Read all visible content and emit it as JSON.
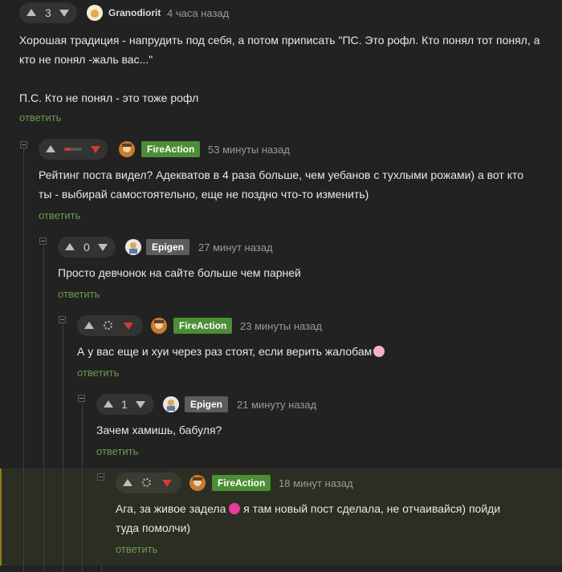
{
  "comments": [
    {
      "rating": "3",
      "author": "Granodiorit",
      "time": "4 часа назад",
      "text_lines": [
        "Хорошая традиция - напрудить под себя, а потом приписать \"ПС. Это рофл. Кто понял тот понял, а",
        "кто не понял -жаль вас...\"",
        "",
        "П.С. Кто не понял - это тоже рофл"
      ],
      "reply": "ответить"
    },
    {
      "author": "FireAction",
      "time": "53 минуты назад",
      "text_lines": [
        "Рейтинг поста видел? Адекватов в 4 раза больше, чем уебанов с тухлыми рожами) а вот кто",
        "ты - выбирай самостоятельно, еще не поздно что-то изменить)"
      ],
      "reply": "ответить"
    },
    {
      "rating": "0",
      "author": "Epigen",
      "time": "27 минут назад",
      "text_lines": [
        "Просто девчонок на сайте больше чем парней"
      ],
      "reply": "ответить"
    },
    {
      "author": "FireAction",
      "time": "23 минуты назад",
      "text": "А у вас еще и хуи через раз стоят, если верить жалобам",
      "reply": "ответить"
    },
    {
      "rating": "1",
      "author": "Epigen",
      "time": "21 минуту назад",
      "text_lines": [
        "Зачем хамишь, бабуля?"
      ],
      "reply": "ответить"
    },
    {
      "author": "FireAction",
      "time": "18 минут назад",
      "text_a": "Ага, за живое задела",
      "text_b": "я там новый пост сделала, не отчаивайся) пойди",
      "text_line2": "туда помолчи)",
      "reply": "ответить"
    }
  ],
  "colors": {
    "accent_green": "#4b8e35",
    "reply_green": "#6a9c50",
    "downvote_red": "#d23a3a",
    "highlight_bar": "#8a7d1e"
  },
  "icons": [
    "arrow-up-icon",
    "arrow-down-icon",
    "clock-icon",
    "collapse-icon",
    "emoji-icon"
  ]
}
